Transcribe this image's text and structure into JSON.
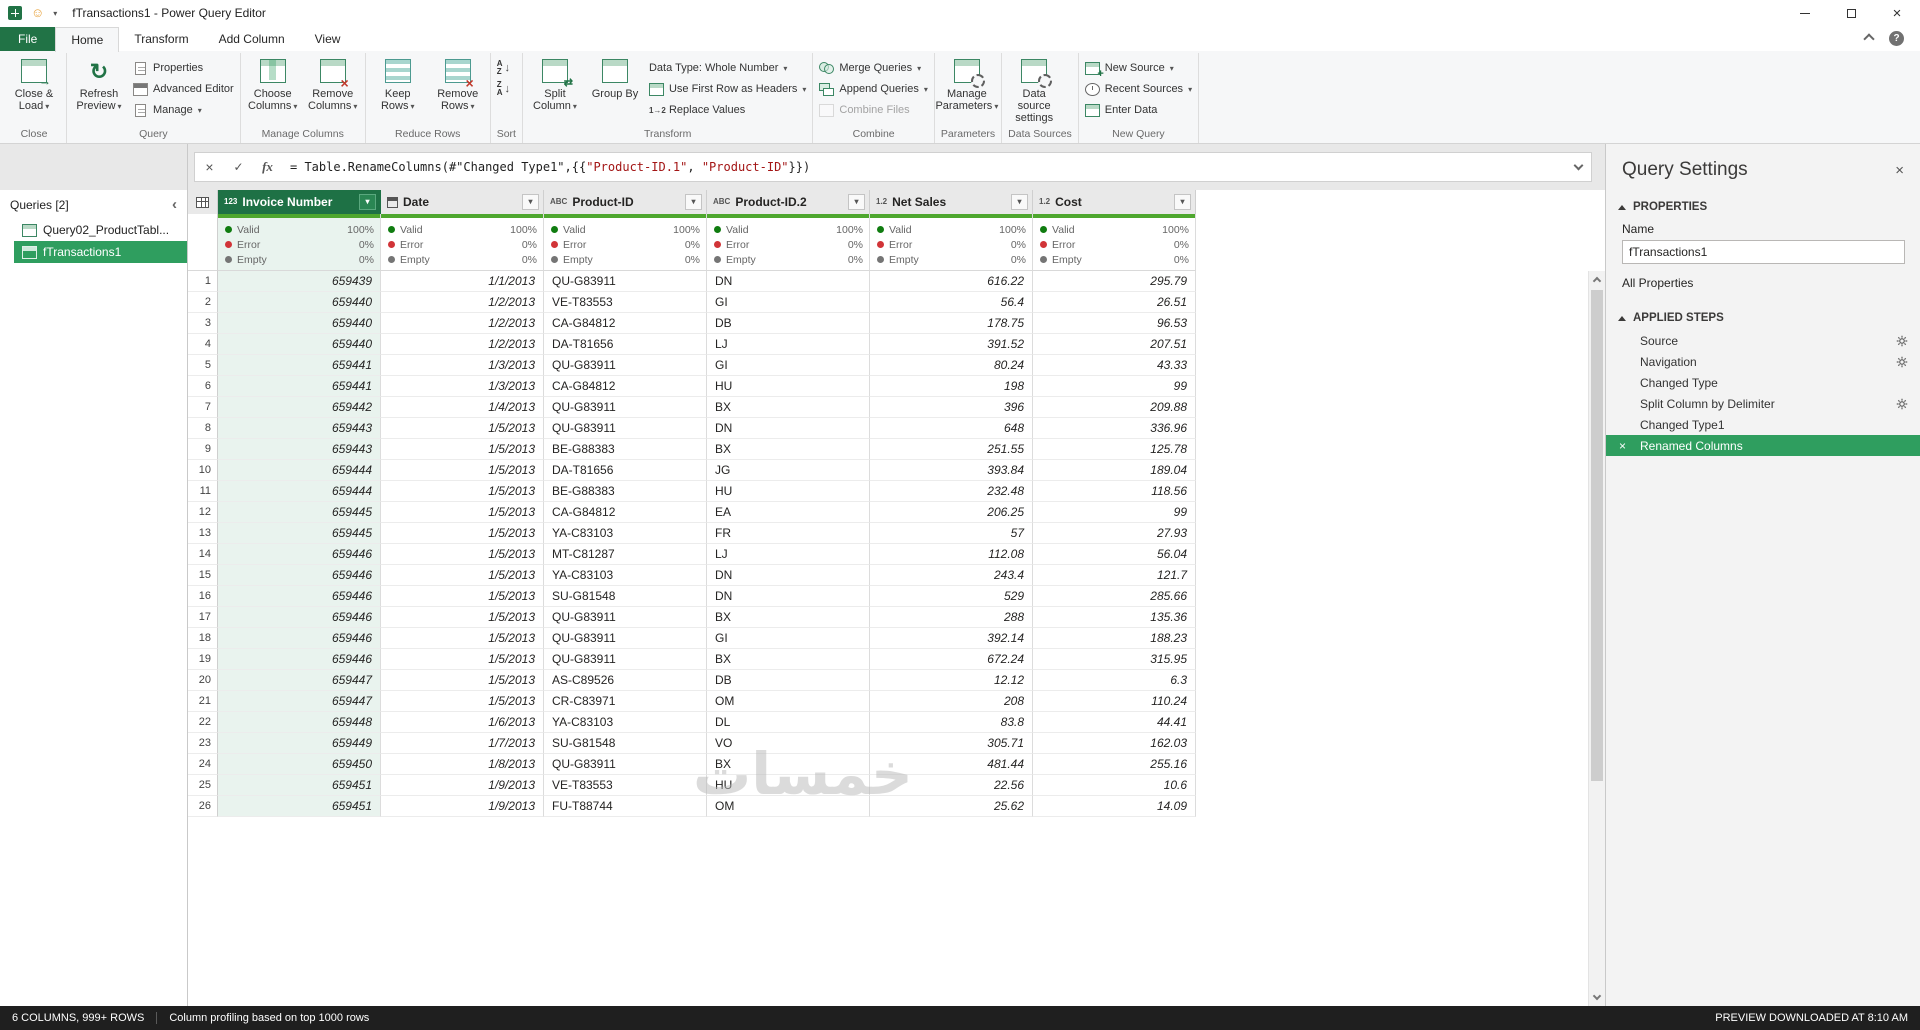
{
  "colors": {
    "accent": "#217346",
    "selection_green": "#2f9e5f",
    "selected_header_green": "#1e7145",
    "quality_bar": "#4ea72e",
    "quality_valid": "#107c10",
    "quality_error": "#d13438",
    "quality_empty": "#757575",
    "status_bar_bg": "#1f1f1f"
  },
  "title_bar": {
    "title": "fTransactions1 - Power Query Editor"
  },
  "tabs": {
    "items": [
      {
        "label": "File",
        "kind": "file"
      },
      {
        "label": "Home",
        "active": true
      },
      {
        "label": "Transform"
      },
      {
        "label": "Add Column"
      },
      {
        "label": "View"
      }
    ]
  },
  "ribbon": {
    "groups": [
      {
        "label": "Close",
        "items": [
          {
            "kind": "big",
            "icon": "close-load",
            "label": "Close & Load",
            "caret": true
          }
        ]
      },
      {
        "label": "Query",
        "items": [
          {
            "kind": "big",
            "icon": "refresh",
            "label": "Refresh Preview",
            "caret": true
          },
          {
            "kind": "stack",
            "buttons": [
              {
                "icon": "properties",
                "label": "Properties"
              },
              {
                "icon": "advanced",
                "label": "Advanced Editor"
              },
              {
                "icon": "manage",
                "label": "Manage",
                "caret": true
              }
            ]
          }
        ]
      },
      {
        "label": "Manage Columns",
        "items": [
          {
            "kind": "big",
            "icon": "choose-cols",
            "label": "Choose Columns",
            "caret": true
          },
          {
            "kind": "big",
            "icon": "remove-cols",
            "label": "Remove Columns",
            "caret": true
          }
        ]
      },
      {
        "label": "Reduce Rows",
        "items": [
          {
            "kind": "big",
            "icon": "keep-rows",
            "label": "Keep Rows",
            "caret": true
          },
          {
            "kind": "big",
            "icon": "remove-rows",
            "label": "Remove Rows",
            "caret": true
          }
        ]
      },
      {
        "label": "Sort",
        "items": [
          {
            "kind": "stack",
            "buttons": [
              {
                "icon": "sort-az"
              },
              {
                "icon": "sort-za"
              }
            ]
          }
        ]
      },
      {
        "label": "Transform",
        "items": [
          {
            "kind": "big",
            "icon": "split",
            "label": "Split Column",
            "caret": true
          },
          {
            "kind": "big",
            "icon": "group",
            "label": "Group By"
          },
          {
            "kind": "stack",
            "buttons": [
              {
                "icon": "none",
                "label": "Data Type: Whole Number",
                "caret": true
              },
              {
                "icon": "table-sm",
                "label": "Use First Row as Headers",
                "caret": true
              },
              {
                "icon": "replace",
                "label": "Replace Values"
              }
            ]
          }
        ]
      },
      {
        "label": "Combine",
        "items": [
          {
            "kind": "stack",
            "buttons": [
              {
                "icon": "merge",
                "label": "Merge Queries",
                "caret": true
              },
              {
                "icon": "append",
                "label": "Append Queries",
                "caret": true
              },
              {
                "icon": "combine",
                "label": "Combine Files",
                "disabled": true
              }
            ]
          }
        ]
      },
      {
        "label": "Parameters",
        "items": [
          {
            "kind": "big",
            "icon": "params",
            "label": "Manage Parameters",
            "caret": true
          }
        ]
      },
      {
        "label": "Data Sources",
        "items": [
          {
            "kind": "big",
            "icon": "datasrc",
            "label": "Data source settings"
          }
        ]
      },
      {
        "label": "New Query",
        "items": [
          {
            "kind": "stack",
            "buttons": [
              {
                "icon": "new-source",
                "label": "New Source",
                "caret": true
              },
              {
                "icon": "recent",
                "label": "Recent Sources",
                "caret": true
              },
              {
                "icon": "enter-data",
                "label": "Enter Data"
              }
            ]
          }
        ]
      }
    ]
  },
  "formula_bar": {
    "segments": [
      {
        "text": "= Table.RenameColumns(#\"Changed Type1\",{{",
        "style": "plain"
      },
      {
        "text": "\"Product-ID.1\"",
        "style": "string"
      },
      {
        "text": ", ",
        "style": "plain"
      },
      {
        "text": "\"Product-ID\"",
        "style": "string"
      },
      {
        "text": "}})",
        "style": "plain"
      }
    ]
  },
  "queries_pane": {
    "header": "Queries [2]",
    "items": [
      {
        "label": "Query02_ProductTabl...",
        "selected": false
      },
      {
        "label": "fTransactions1",
        "selected": true
      }
    ]
  },
  "table": {
    "columns": [
      {
        "name": "Invoice Number",
        "type_icon": "123",
        "numeric": true,
        "selected": true
      },
      {
        "name": "Date",
        "type_icon": "calendar",
        "numeric": true
      },
      {
        "name": "Product-ID",
        "type_icon": "ABC"
      },
      {
        "name": "Product-ID.2",
        "type_icon": "ABC"
      },
      {
        "name": "Net Sales",
        "type_icon": "1.2",
        "numeric": true
      },
      {
        "name": "Cost",
        "type_icon": "1.2",
        "numeric": true
      }
    ],
    "quality": [
      {
        "label": "Valid",
        "value": "100%",
        "color": "#107c10"
      },
      {
        "label": "Error",
        "value": "0%",
        "color": "#d13438"
      },
      {
        "label": "Empty",
        "value": "0%",
        "color": "#757575"
      }
    ],
    "rows": [
      [
        "659439",
        "1/1/2013",
        "QU-G83911",
        "DN",
        "616.22",
        "295.79"
      ],
      [
        "659440",
        "1/2/2013",
        "VE-T83553",
        "GI",
        "56.4",
        "26.51"
      ],
      [
        "659440",
        "1/2/2013",
        "CA-G84812",
        "DB",
        "178.75",
        "96.53"
      ],
      [
        "659440",
        "1/2/2013",
        "DA-T81656",
        "LJ",
        "391.52",
        "207.51"
      ],
      [
        "659441",
        "1/3/2013",
        "QU-G83911",
        "GI",
        "80.24",
        "43.33"
      ],
      [
        "659441",
        "1/3/2013",
        "CA-G84812",
        "HU",
        "198",
        "99"
      ],
      [
        "659442",
        "1/4/2013",
        "QU-G83911",
        "BX",
        "396",
        "209.88"
      ],
      [
        "659443",
        "1/5/2013",
        "QU-G83911",
        "DN",
        "648",
        "336.96"
      ],
      [
        "659443",
        "1/5/2013",
        "BE-G88383",
        "BX",
        "251.55",
        "125.78"
      ],
      [
        "659444",
        "1/5/2013",
        "DA-T81656",
        "JG",
        "393.84",
        "189.04"
      ],
      [
        "659444",
        "1/5/2013",
        "BE-G88383",
        "HU",
        "232.48",
        "118.56"
      ],
      [
        "659445",
        "1/5/2013",
        "CA-G84812",
        "EA",
        "206.25",
        "99"
      ],
      [
        "659445",
        "1/5/2013",
        "YA-C83103",
        "FR",
        "57",
        "27.93"
      ],
      [
        "659446",
        "1/5/2013",
        "MT-C81287",
        "LJ",
        "112.08",
        "56.04"
      ],
      [
        "659446",
        "1/5/2013",
        "YA-C83103",
        "DN",
        "243.4",
        "121.7"
      ],
      [
        "659446",
        "1/5/2013",
        "SU-G81548",
        "DN",
        "529",
        "285.66"
      ],
      [
        "659446",
        "1/5/2013",
        "QU-G83911",
        "BX",
        "288",
        "135.36"
      ],
      [
        "659446",
        "1/5/2013",
        "QU-G83911",
        "GI",
        "392.14",
        "188.23"
      ],
      [
        "659446",
        "1/5/2013",
        "QU-G83911",
        "BX",
        "672.24",
        "315.95"
      ],
      [
        "659447",
        "1/5/2013",
        "AS-C89526",
        "DB",
        "12.12",
        "6.3"
      ],
      [
        "659447",
        "1/5/2013",
        "CR-C83971",
        "OM",
        "208",
        "110.24"
      ],
      [
        "659448",
        "1/6/2013",
        "YA-C83103",
        "DL",
        "83.8",
        "44.41"
      ],
      [
        "659449",
        "1/7/2013",
        "SU-G81548",
        "VO",
        "305.71",
        "162.03"
      ],
      [
        "659450",
        "1/8/2013",
        "QU-G83911",
        "BX",
        "481.44",
        "255.16"
      ],
      [
        "659451",
        "1/9/2013",
        "VE-T83553",
        "HU",
        "22.56",
        "10.6"
      ],
      [
        "659451",
        "1/9/2013",
        "FU-T88744",
        "OM",
        "25.62",
        "14.09"
      ]
    ]
  },
  "query_settings": {
    "title": "Query Settings",
    "properties_header": "PROPERTIES",
    "name_label": "Name",
    "name_value": "fTransactions1",
    "all_properties": "All Properties",
    "applied_steps_header": "APPLIED STEPS",
    "steps": [
      {
        "label": "Source",
        "gear": true
      },
      {
        "label": "Navigation",
        "gear": true
      },
      {
        "label": "Changed Type"
      },
      {
        "label": "Split Column by Delimiter",
        "gear": true
      },
      {
        "label": "Changed Type1"
      },
      {
        "label": "Renamed Columns",
        "selected": true,
        "deletable": true
      }
    ]
  },
  "status_bar": {
    "columns_rows": "6 COLUMNS, 999+ ROWS",
    "profiling": "Column profiling based on top 1000 rows",
    "preview": "PREVIEW DOWNLOADED AT 8:10 AM"
  },
  "watermark": {
    "text": "خمسات"
  }
}
